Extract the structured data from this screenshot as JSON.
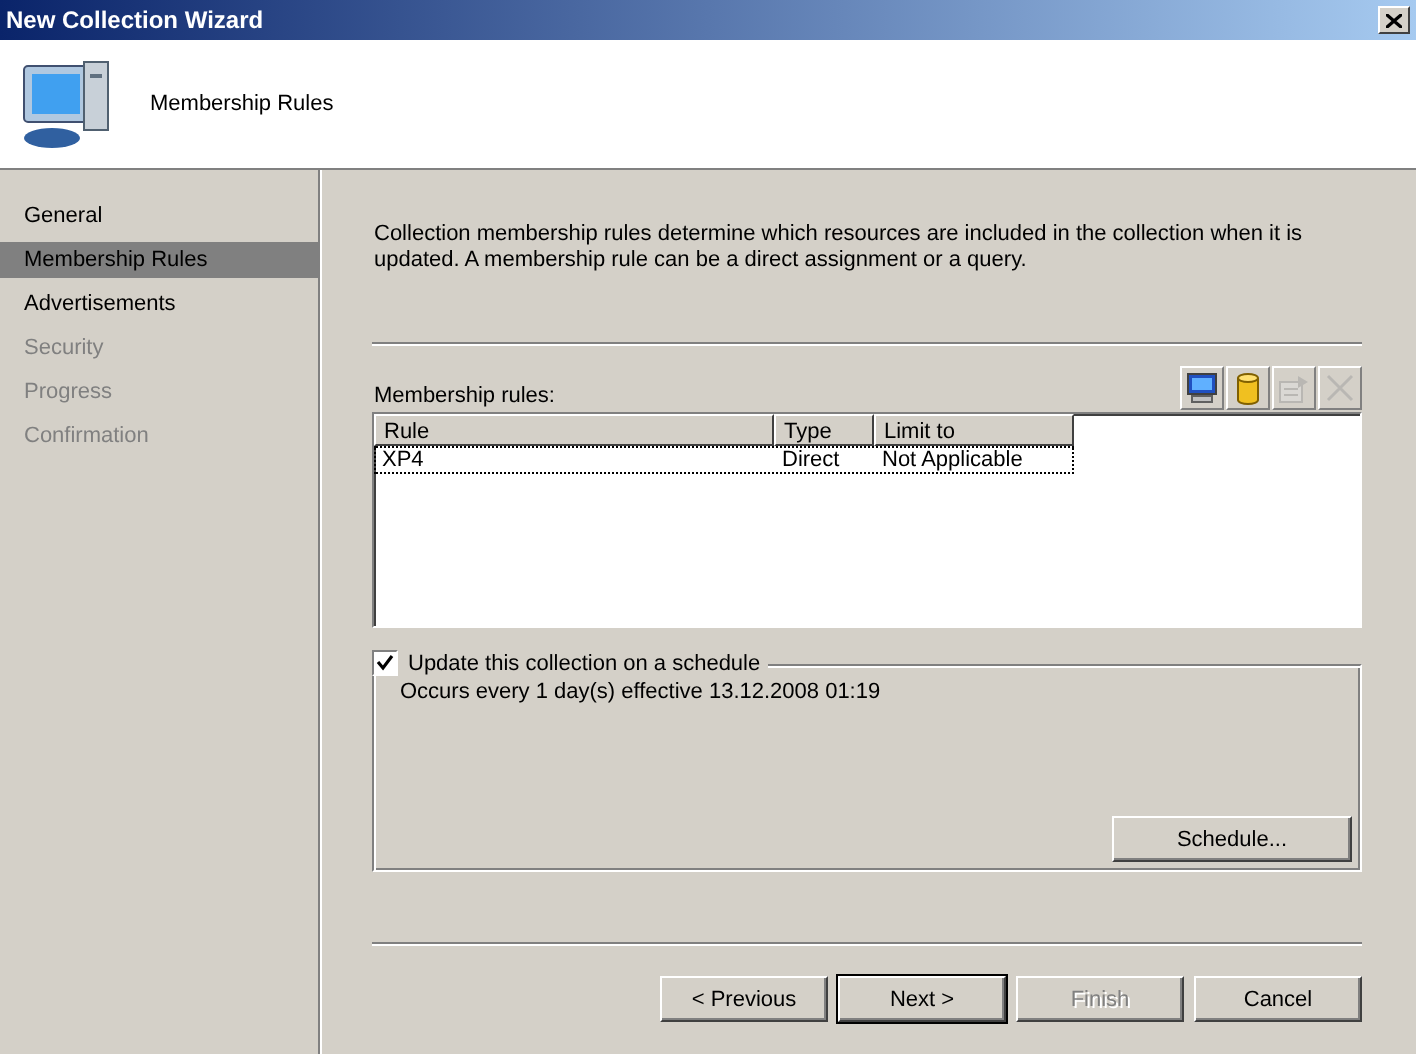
{
  "window": {
    "title": "New Collection Wizard"
  },
  "header": {
    "title": "Membership Rules"
  },
  "sidebar": {
    "items": [
      {
        "label": "General",
        "selected": false,
        "disabled": false
      },
      {
        "label": "Membership Rules",
        "selected": true,
        "disabled": false
      },
      {
        "label": "Advertisements",
        "selected": false,
        "disabled": false
      },
      {
        "label": "Security",
        "selected": false,
        "disabled": true
      },
      {
        "label": "Progress",
        "selected": false,
        "disabled": true
      },
      {
        "label": "Confirmation",
        "selected": false,
        "disabled": true
      }
    ]
  },
  "description": "Collection membership rules determine which resources are included in the collection when it is updated. A membership rule can be a direct assignment or a query.",
  "rules": {
    "label": "Membership rules:",
    "toolbar": [
      {
        "kind": "computer",
        "disabled": false
      },
      {
        "kind": "database",
        "disabled": false
      },
      {
        "kind": "properties",
        "disabled": true
      },
      {
        "kind": "delete",
        "disabled": true
      }
    ],
    "table": {
      "columns": [
        "Rule",
        "Type",
        "Limit to"
      ],
      "rows": [
        {
          "cells": [
            "XP4",
            "Direct",
            "Not Applicable"
          ],
          "selected": true
        }
      ]
    }
  },
  "schedule": {
    "label": "Update this collection on a schedule",
    "checked": true,
    "description": "Occurs every 1 day(s) effective 13.12.2008 01:19",
    "button": "Schedule..."
  },
  "buttons": [
    {
      "label": "< Previous",
      "disabled": false,
      "default": false
    },
    {
      "label": "Next >",
      "disabled": false,
      "default": true
    },
    {
      "label": "Finish",
      "disabled": true,
      "default": false
    },
    {
      "label": "Cancel",
      "disabled": false,
      "default": false
    }
  ]
}
